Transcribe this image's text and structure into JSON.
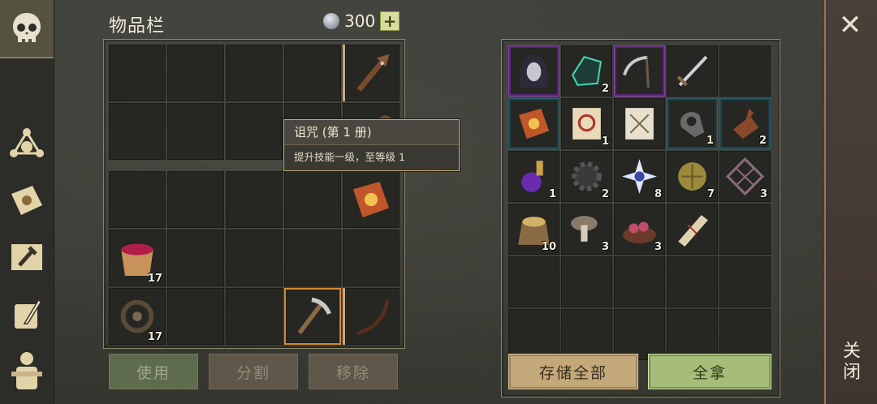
{
  "header": {
    "title": "物品栏",
    "currency_amount": "300",
    "add_label": "+"
  },
  "tooltip": {
    "title": "诅咒 (第 1 册)",
    "description": "提升技能一级，至等级 1"
  },
  "left_inventory": {
    "top_rows": [
      [
        {
          "icon": ""
        },
        {
          "icon": ""
        },
        {
          "icon": ""
        },
        {
          "icon": ""
        },
        {
          "icon": "spiked-club-icon"
        }
      ],
      [
        {
          "icon": ""
        },
        {
          "icon": ""
        },
        {
          "icon": ""
        },
        {
          "icon": ""
        },
        {
          "icon": "item-icon"
        }
      ]
    ],
    "bottom_rows": [
      [
        {
          "icon": ""
        },
        {
          "icon": ""
        },
        {
          "icon": ""
        },
        {
          "icon": ""
        },
        {
          "icon": "sun-book-icon"
        }
      ],
      [
        {
          "icon": "berry-bucket-icon",
          "count": "17"
        },
        {
          "icon": ""
        },
        {
          "icon": ""
        },
        {
          "icon": ""
        },
        {
          "icon": ""
        }
      ],
      [
        {
          "icon": "bear-trap-icon",
          "count": "17"
        },
        {
          "icon": ""
        },
        {
          "icon": ""
        },
        {
          "icon": "pickaxe-icon"
        },
        {
          "icon": "bow-icon"
        }
      ]
    ]
  },
  "right_inventory": {
    "rows": [
      [
        {
          "icon": "hooded-woman-icon",
          "rarity": "epic"
        },
        {
          "icon": "crystal-ore-icon",
          "count": "2"
        },
        {
          "icon": "scythe-icon",
          "rarity": "epic"
        },
        {
          "icon": "sword-icon"
        },
        {
          "icon": ""
        }
      ],
      [
        {
          "icon": "sun-book-icon",
          "rarity": "rare"
        },
        {
          "icon": "red-scroll-icon",
          "count": "1"
        },
        {
          "icon": "map-scroll-icon"
        },
        {
          "icon": "iron-clamp-icon",
          "count": "1",
          "rarity": "rare"
        },
        {
          "icon": "bottle-icon",
          "count": "2",
          "rarity": "rare"
        }
      ],
      [
        {
          "icon": "purple-potion-icon",
          "count": "1"
        },
        {
          "icon": "gear-icon",
          "count": "2"
        },
        {
          "icon": "star-crystal-icon",
          "count": "8"
        },
        {
          "icon": "seed-ball-icon",
          "count": "7"
        },
        {
          "icon": "net-frame-icon",
          "count": "3"
        }
      ],
      [
        {
          "icon": "grain-sack-icon",
          "count": "10"
        },
        {
          "icon": "mushroom-icon",
          "count": "3"
        },
        {
          "icon": "meat-bowl-icon",
          "count": "3"
        },
        {
          "icon": "parchment-roll-icon"
        },
        {
          "icon": ""
        }
      ],
      [
        {
          "icon": ""
        },
        {
          "icon": ""
        },
        {
          "icon": ""
        },
        {
          "icon": ""
        },
        {
          "icon": ""
        }
      ],
      [
        {
          "icon": ""
        },
        {
          "icon": ""
        },
        {
          "icon": ""
        },
        {
          "icon": ""
        },
        {
          "icon": ""
        }
      ]
    ]
  },
  "buttons": {
    "use": "使用",
    "split": "分割",
    "remove": "移除",
    "store_all": "存储全部",
    "take_all": "全拿"
  },
  "close": {
    "label": "关闭",
    "x": "✕"
  },
  "colors": {
    "accent_gold": "#c9b27a",
    "epic": "#8a3fb3",
    "rare": "#2e5e6a",
    "take_all_green": "#a5bd78"
  }
}
